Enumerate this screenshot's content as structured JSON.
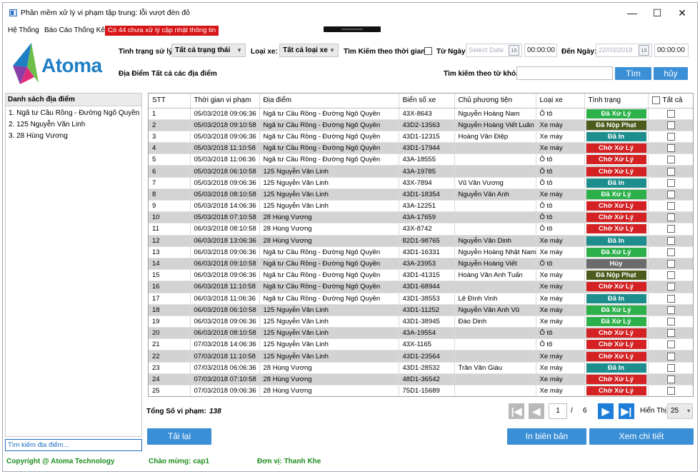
{
  "window": {
    "title": "Phần mềm xử lý vi phạm tập trung: lỗi vượt đèn đỏ",
    "minimize": "—",
    "maximize": "☐",
    "close": "✕"
  },
  "menu": {
    "system": "Hệ Thống",
    "report": "Báo Cáo Thống Kê",
    "notification": "Có 44 chưa xử lý cập nhật thông tin"
  },
  "logo": {
    "text": "Atoma"
  },
  "filters": {
    "status_label": "Tình trạng sử lý:",
    "status_value": "Tất cả trạng thái",
    "vehicle_label": "Loại xe:",
    "vehicle_value": "Tất cả loại xe",
    "time_search_label": "Tìm Kiếm theo thời gian:",
    "from_label": "Từ Ngày:",
    "from_placeholder": "Select Date",
    "from_time": "00:00:00",
    "to_label": "Đến Ngày:",
    "to_date": "22/03/2018",
    "to_time": "00:00:00",
    "calendar_day": "15",
    "location_label": "Địa Điểm",
    "location_value": "Tất cả các địa điểm",
    "keyword_label": "Tìm kiếm theo từ khóa:",
    "keyword_value": "",
    "search_button": "Tìm",
    "cancel_button": "hủy"
  },
  "sidebar": {
    "title": "Danh sách địa điểm",
    "items": [
      "1. Ngã tư Cầu Rồng - Đường Ngô Quyền",
      "2. 125 Nguyễn Văn Linh",
      "3. 28 Hùng Vương"
    ],
    "search_placeholder": "Tìm kiếm địa điểm..."
  },
  "table": {
    "columns": [
      "STT",
      "Thời gian vi phạm",
      "Địa điểm",
      "Biển số xe",
      "Chủ phương tiện",
      "Loại xe",
      "Tình trạng",
      "Tất cả"
    ],
    "rows": [
      {
        "stt": "1",
        "time": "05/03/2018 09:06:36",
        "place": "Ngã tư Cầu Rồng - Đường Ngô Quyền",
        "plate": "43X-8643",
        "owner": "Nguyễn Hoàng Nam",
        "type": "Ô tô",
        "status": "Đã Xử Lý"
      },
      {
        "stt": "2",
        "time": "05/03/2018 09:10:58",
        "place": "Ngã tư Cầu Rồng - Đường Ngô Quyền",
        "plate": "43D2-13563",
        "owner": "Nguyễn Hoàng Viết Luân",
        "type": "Xe máy",
        "status": "Đã Nộp Phạt"
      },
      {
        "stt": "3",
        "time": "05/03/2018 09:06:36",
        "place": "Ngã tư Cầu Rồng - Đường Ngô Quyền",
        "plate": "43D1-12315",
        "owner": "Hoàng Văn Điệp",
        "type": "Xe máy",
        "status": "Đã In"
      },
      {
        "stt": "4",
        "time": "05/03/2018 11:10:58",
        "place": "Ngã tư Cầu Rồng - Đường Ngô Quyền",
        "plate": "43D1-17944",
        "owner": "",
        "type": "Xe máy",
        "status": "Chờ Xử Lý"
      },
      {
        "stt": "5",
        "time": "05/03/2018 11:06:36",
        "place": "Ngã tư Cầu Rồng - Đường Ngô Quyền",
        "plate": "43A-18555",
        "owner": "",
        "type": "Ô tô",
        "status": "Chờ Xử Lý"
      },
      {
        "stt": "6",
        "time": "05/03/2018 06:10:58",
        "place": "125 Nguyễn Văn Linh",
        "plate": "43A-19785",
        "owner": "",
        "type": "Ô tô",
        "status": "Chờ Xử Lý"
      },
      {
        "stt": "7",
        "time": "05/03/2018 09:06:36",
        "place": "125 Nguyễn Văn Linh",
        "plate": "43X-7894",
        "owner": "Vũ Văn Vương",
        "type": "Ô tô",
        "status": "Đã In"
      },
      {
        "stt": "8",
        "time": "05/03/2018 08:10:58",
        "place": "125 Nguyễn Văn Linh",
        "plate": "43D1-18354",
        "owner": "Nguyễn Văn Anh",
        "type": "Xe máy",
        "status": "Đã Xử Lý"
      },
      {
        "stt": "9",
        "time": "05/03/2018 14:06:36",
        "place": "125 Nguyễn Văn Linh",
        "plate": "43A-12251",
        "owner": "",
        "type": "Ô tô",
        "status": "Chờ Xử Lý"
      },
      {
        "stt": "10",
        "time": "05/03/2018 07:10:58",
        "place": "28 Hùng Vương",
        "plate": "43A-17659",
        "owner": "",
        "type": "Ô tô",
        "status": "Chờ Xử Lý"
      },
      {
        "stt": "11",
        "time": "06/03/2018 08:10:58",
        "place": "28 Hùng Vương",
        "plate": "43X-8742",
        "owner": "",
        "type": "Ô tô",
        "status": "Chờ Xử Lý"
      },
      {
        "stt": "12",
        "time": "06/03/2018 13:06:36",
        "place": "28 Hùng Vương",
        "plate": "82D1-98765",
        "owner": "Nguyễn Văn Dinh",
        "type": "Xe máy",
        "status": "Đã In"
      },
      {
        "stt": "13",
        "time": "06/03/2018 09:06:36",
        "place": "Ngã tư Cầu Rồng - Đường Ngô Quyền",
        "plate": "43D1-16331",
        "owner": "Nguyễn Hoàng Nhật Nam",
        "type": "Xe máy",
        "status": "Đã Xử Lý"
      },
      {
        "stt": "14",
        "time": "06/03/2018 09:10:58",
        "place": "Ngã tư Cầu Rồng - Đường Ngô Quyền",
        "plate": "43A-23953",
        "owner": "Nguyễn Hoàng Viết",
        "type": "Ô tô",
        "status": "Hủy"
      },
      {
        "stt": "15",
        "time": "06/03/2018 09:06:36",
        "place": "Ngã tư Cầu Rồng - Đường Ngô Quyền",
        "plate": "43D1-41315",
        "owner": "Hoàng Văn Anh Tuấn",
        "type": "Xe máy",
        "status": "Đã Nộp Phạt"
      },
      {
        "stt": "16",
        "time": "06/03/2018 11:10:58",
        "place": "Ngã tư Cầu Rồng - Đường Ngô Quyền",
        "plate": "43D1-68944",
        "owner": "",
        "type": "Xe máy",
        "status": "Chờ Xử Lý"
      },
      {
        "stt": "17",
        "time": "06/03/2018 11:06:36",
        "place": "Ngã tư Cầu Rồng - Đường Ngô Quyền",
        "plate": "43D1-38553",
        "owner": "Lê Đình Vinh",
        "type": "Xe máy",
        "status": "Đã In"
      },
      {
        "stt": "18",
        "time": "06/03/2018 06:10:58",
        "place": "125 Nguyễn Văn Linh",
        "plate": "43D1-11252",
        "owner": "Nguyễn Văn Anh Vũ",
        "type": "Xe máy",
        "status": "Đã Xử Lý"
      },
      {
        "stt": "19",
        "time": "06/03/2018 09:06:36",
        "place": "125 Nguyễn Văn Linh",
        "plate": "43D1-38945",
        "owner": "Đào Dinh",
        "type": "Xe máy",
        "status": "Đã Xử Lý"
      },
      {
        "stt": "20",
        "time": "06/03/2018 08:10:58",
        "place": "125 Nguyễn Văn Linh",
        "plate": "43A-19554",
        "owner": "",
        "type": "Ô tô",
        "status": "Chờ Xử Lý"
      },
      {
        "stt": "21",
        "time": "07/03/2018 14:06:36",
        "place": "125 Nguyễn Văn Linh",
        "plate": "43X-1165",
        "owner": "",
        "type": "Ô tô",
        "status": "Chờ Xử Lý"
      },
      {
        "stt": "22",
        "time": "07/03/2018 11:10:58",
        "place": "125 Nguyễn Văn Linh",
        "plate": "43D1-23564",
        "owner": "",
        "type": "Xe máy",
        "status": "Chờ Xử Lý"
      },
      {
        "stt": "23",
        "time": "07/03/2018 06:06:36",
        "place": "28 Hùng Vương",
        "plate": "43D1-28532",
        "owner": "Trần Văn Giàu",
        "type": "Xe máy",
        "status": "Đã In"
      },
      {
        "stt": "24",
        "time": "07/03/2018 07:10:58",
        "place": "28 Hùng Vương",
        "plate": "48D1-36542",
        "owner": "",
        "type": "Xe máy",
        "status": "Chờ Xử Lý"
      },
      {
        "stt": "25",
        "time": "07/03/2018 09:06:36",
        "place": "28 Hùng Vương",
        "plate": "75D1-15689",
        "owner": "",
        "type": "Xe máy",
        "status": "Chờ Xử Lý"
      }
    ]
  },
  "summary": {
    "total_label": "Tổng Số vi phạm:",
    "total_value": "138"
  },
  "pagination": {
    "current": "1",
    "separator": "/",
    "total_pages": "6",
    "page_size_label": "Hiển Thị:",
    "page_size": "25"
  },
  "actions": {
    "reload": "Tải lại",
    "print": "In biên bản",
    "details": "Xem chi tiết"
  },
  "footer": {
    "copyright": "Copyright @ Atoma Technology",
    "greeting": "Chào mừng: cap1",
    "unit": "Đơn vị: Thanh Khe"
  },
  "colors": {
    "accent": "#3b8fd6",
    "notify": "#d71416",
    "done": "#2bb04a",
    "paid": "#4b5b1c",
    "printed": "#1e8d8d",
    "pending": "#d42123",
    "cancelled": "#6b6b6b",
    "footer_green": "#1d8c1d"
  }
}
